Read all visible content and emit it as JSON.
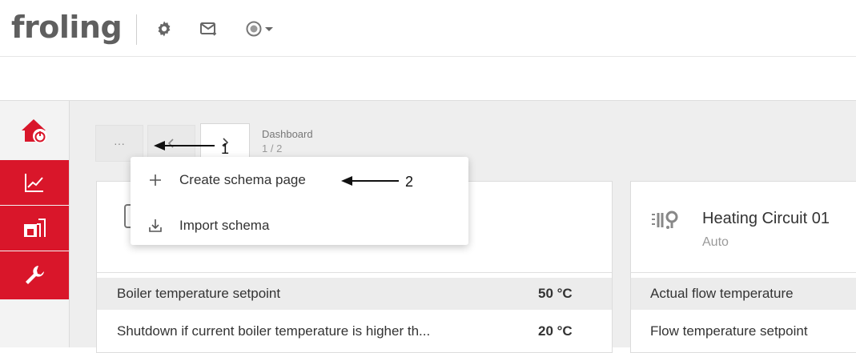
{
  "header": {
    "logo_text": "froling"
  },
  "toolbar": {
    "more_label": "···",
    "dashboard_title": "Dashboard",
    "page_indicator": "1 / 2"
  },
  "menu": {
    "items": [
      {
        "icon": "plus-icon",
        "label": "Create schema page"
      },
      {
        "icon": "import-icon",
        "label": "Import schema"
      }
    ]
  },
  "annotations": {
    "arrow1_label": "1",
    "arrow2_label": "2"
  },
  "boiler_card": {
    "rows": [
      {
        "label": "Boiler temperature setpoint",
        "value": "50 °C"
      },
      {
        "label": "Shutdown if current boiler temperature is higher th...",
        "value": "20 °C"
      }
    ]
  },
  "heating_card": {
    "title": "Heating Circuit 01",
    "subtitle": "Auto",
    "rows": [
      {
        "label": "Actual flow temperature"
      },
      {
        "label": "Flow temperature setpoint"
      }
    ]
  },
  "colors": {
    "accent_red": "#d9162a",
    "logo_gray": "#5f5f5f"
  }
}
